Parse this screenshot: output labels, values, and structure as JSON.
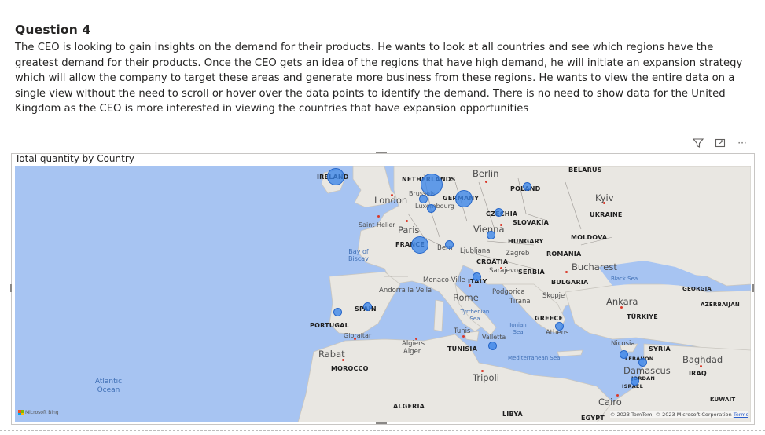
{
  "question": {
    "title": "Question 4",
    "body": "The CEO is looking to gain insights on the demand for their products. He wants to look at all countries and see which regions have the greatest demand for their products. Once the CEO gets an idea of the regions that have high demand, he will initiate an expansion strategy which will allow the company to target these areas and generate more business from these regions. He wants to view the entire data on a single view without the need to scroll or hover over the data points to identify the demand. There is no need to show data for the United Kingdom as the CEO is more interested in viewing the countries that have expansion opportunities"
  },
  "toolbar": {
    "icons": [
      "filter-icon",
      "focus-mode-icon",
      "more-options-icon"
    ],
    "more_label": "···"
  },
  "visual": {
    "title": "Total quantity by Country",
    "bing_label": "Microsoft Bing",
    "copyright": "© 2023 TomTom, © 2023 Microsoft Corporation",
    "terms": "Terms"
  },
  "map_labels": {
    "countries": [
      "IRELAND",
      "NETHERLANDS",
      "GERMANY",
      "POLAND",
      "BELARUS",
      "UKRAINE",
      "CZECHIA",
      "SLOVAKIA",
      "HUNGARY",
      "MOLDOVA",
      "ROMANIA",
      "FRANCE",
      "CROATIA",
      "SERBIA",
      "BULGARIA",
      "ITALY",
      "SPAIN",
      "PORTUGAL",
      "MOROCCO",
      "ALGERIA",
      "TUNISIA",
      "GREECE",
      "TÜRKIYE",
      "SYRIA",
      "LEBANON",
      "JORDAN",
      "ISRAEL",
      "IRAQ",
      "GEORGIA",
      "AZERBAIJAN",
      "KUWAIT",
      "LIBYA",
      "EGYPT"
    ],
    "cities": [
      "Berlin",
      "London",
      "Brussels",
      "Luxembourg",
      "Kyiv",
      "Paris",
      "Saint Helier",
      "Vienna",
      "Bern",
      "Ljubljana",
      "Zagreb",
      "Bucharest",
      "Sarajevo",
      "Monaco-Ville",
      "Andorra la Vella",
      "Podgorica",
      "Skopje",
      "Rome",
      "Tirana",
      "Ankara",
      "Tunis",
      "Valletta",
      "Athens",
      "Nicosia",
      "Damascus",
      "Baghdad",
      "Rabat",
      "Gibraltar",
      "Algiers",
      "Alger",
      "Tripoli",
      "Cairo"
    ],
    "waters": [
      "Bay of Biscay",
      "Black Sea",
      "Tyrrhenian Sea",
      "Ionian Sea",
      "Mediterranean Sea",
      "Atlantic Ocean"
    ]
  },
  "chart_data": {
    "type": "map-bubble",
    "title": "Total quantity by Country",
    "size_measure": "Total quantity",
    "points": [
      {
        "country": "Ireland",
        "size": 3
      },
      {
        "country": "Netherlands",
        "size": 4
      },
      {
        "country": "Belgium",
        "size": 1
      },
      {
        "country": "Luxembourg",
        "size": 1
      },
      {
        "country": "Germany",
        "size": 3
      },
      {
        "country": "Poland",
        "size": 1
      },
      {
        "country": "Czechia",
        "size": 1
      },
      {
        "country": "Austria",
        "size": 1
      },
      {
        "country": "Switzerland",
        "size": 1
      },
      {
        "country": "France",
        "size": 3
      },
      {
        "country": "Italy",
        "size": 1
      },
      {
        "country": "Spain",
        "size": 1
      },
      {
        "country": "Portugal",
        "size": 1
      },
      {
        "country": "Malta",
        "size": 1
      },
      {
        "country": "Greece",
        "size": 1
      },
      {
        "country": "Cyprus",
        "size": 1
      },
      {
        "country": "Lebanon",
        "size": 1
      },
      {
        "country": "Israel",
        "size": 1
      }
    ]
  }
}
